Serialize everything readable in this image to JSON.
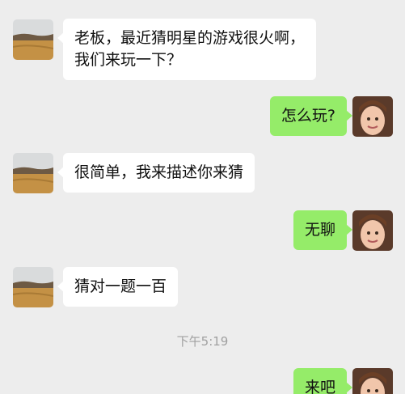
{
  "colors": {
    "background": "#ededed",
    "incoming_bubble": "#ffffff",
    "outgoing_bubble": "#95ec69",
    "timestamp": "#a0a0a0"
  },
  "messages": [
    {
      "side": "left",
      "lines": [
        "老板，最近猜明星的游戏很火啊，",
        "我们来玩一下？"
      ]
    },
    {
      "side": "right",
      "lines": [
        "怎么玩?"
      ]
    },
    {
      "side": "left",
      "lines": [
        "很简单，我来描述你来猜"
      ]
    },
    {
      "side": "right",
      "lines": [
        "无聊"
      ]
    },
    {
      "side": "left",
      "lines": [
        "猜对一题一百"
      ]
    },
    {
      "side": "right",
      "lines": [
        "来吧"
      ]
    }
  ],
  "timestamp": "下午5:19",
  "avatars": {
    "left": "landscape-avatar-icon",
    "right": "girl-avatar-icon"
  }
}
